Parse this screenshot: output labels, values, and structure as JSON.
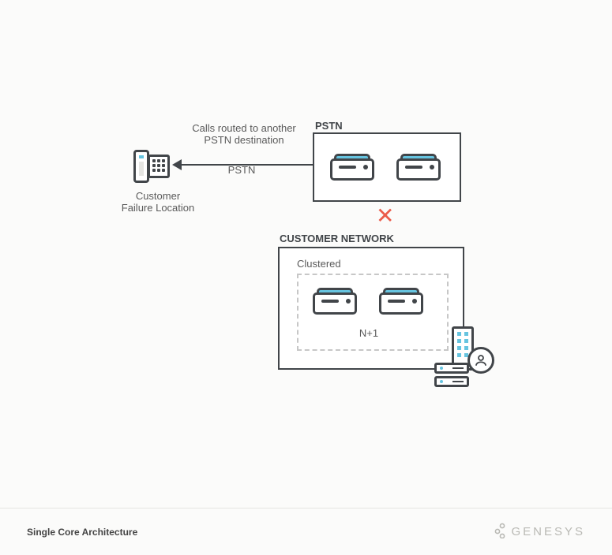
{
  "pstn": {
    "label": "PSTN"
  },
  "arrow": {
    "topLabel": "Calls routed to another\nPSTN destination",
    "bottomLabel": "PSTN"
  },
  "customer": {
    "deviceLabel": "Customer\nFailure Location"
  },
  "customerNetwork": {
    "label": "CUSTOMER NETWORK",
    "clusteredLabel": "Clustered",
    "nPlus1": "N+1"
  },
  "footer": {
    "title": "Single Core Architecture",
    "brand": "GENESYS"
  },
  "colors": {
    "stroke": "#414549",
    "accent": "#66c4e0",
    "error": "#eb5b4a",
    "muted": "#b9b9b4"
  }
}
